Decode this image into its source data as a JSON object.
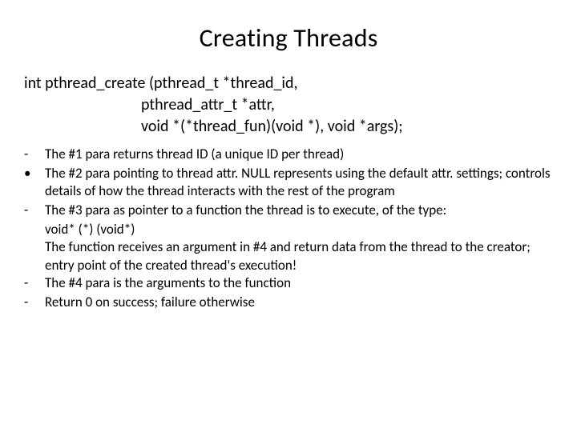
{
  "title": "Creating Threads",
  "sig": {
    "line1": "int   pthread_create (pthread_t *thread_id,",
    "line2": "pthread_attr_t *attr,",
    "line3": "void *(*thread_fun)(void *),   void *args);"
  },
  "bullets": {
    "m1": "-",
    "t1": "The #1 para returns thread ID (a unique ID per thread)",
    "m2": "•",
    "t2": "The #2 para pointing to thread attr. NULL represents using the default attr. settings; controls details of how the thread interacts with the rest of the program",
    "m3": "-",
    "t3": "The #3 para as pointer to a function the thread is to execute, of the type:",
    "t3a": " void* (*) (void*)",
    "t3b": " The function receives an argument in #4 and return data from the thread to the creator; entry point of the created thread's execution!",
    "m4": "-",
    "t4": "The #4 para is the arguments to the function",
    "m5": "-",
    "t5": "Return 0 on success; failure otherwise"
  }
}
